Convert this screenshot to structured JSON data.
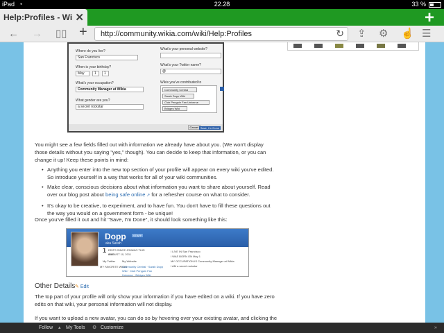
{
  "status": {
    "carrier": "iPad",
    "wifi": "WiFi",
    "time": "22.28",
    "battery": "33 %",
    "battery_level": 0.33
  },
  "tab": {
    "title": "Help:Profiles - Wiki",
    "close": "✕"
  },
  "toolbar": {
    "url": "http://community.wikia.com/wiki/Help:Profiles"
  },
  "screenshot_form": {
    "fields": [
      {
        "label": "Where do you live?",
        "value": "San Francisco"
      },
      {
        "label": "When is your birthday?",
        "month": "May",
        "day": "1",
        "year": "1"
      },
      {
        "label": "What's your occupation?",
        "value": "Community Manager at Wikia"
      },
      {
        "label": "What gender are you?",
        "value": "a secret rockstar"
      }
    ],
    "right_fields": [
      {
        "label": "What's your personal website?",
        "value": ""
      },
      {
        "label": "What's your Twitter name?",
        "value": "@"
      },
      {
        "label": "Wikis you've contributed to",
        "value": ""
      }
    ],
    "wikis": [
      "Community Central",
      "Sarah Dopp Wiki",
      "Club Penguin Fan Universe",
      "Bridges Wiki"
    ],
    "cancel": "Cancel",
    "save": "Save, I'm Done"
  },
  "paragraph1": "You might see a few fields filled out with information we already have about you. (We won't display those details without you saying \"yes,\" though). You can decide to keep that information, or you can change it up! Keep these points in mind:",
  "bullets": [
    "Anything you enter into the new top section of your profile will appear on every wiki you've edited. So introduce yourself in a way that works for all of your wiki communities.",
    {
      "before": "Make clear, conscious decisions about what information you want to share about yourself. Read over our blog post about ",
      "link": "being safe online",
      "after": " for a refresher course on what to consider."
    },
    "It's okay to be creative, to experiment, and to have fun. You don't have to fill these questions out the way you would on a government form - be unique!"
  ],
  "paragraph2": "Once you've filled it out and hit \"Save, I'm Done\", it should look something like this:",
  "dopp": {
    "name": "Dopp",
    "badge": "STAFF",
    "aka": "aka Sarah",
    "edits_count": "1",
    "edits_label": "EDITS SINCE JOINING THIS WIKI",
    "joined": "AUGUST 10, 2011",
    "twitter": "My Twitter",
    "website": "My Website",
    "favorite_wikis_label": "MY FAVORITE WIKIS",
    "favorite_wikis": "Community Central · Sarah Dopp Wiki · Club Penguin Fan Universe · Bridges Wiki",
    "live": "I LIVE IN San Francisco",
    "born": "I WAS BORN ON May 1",
    "occupation": "MY OCCUPATION IS Community Manager at Wikia",
    "gender": "I AM a secret rockstar"
  },
  "other_details": {
    "heading": "Other Details",
    "edit": "Edit"
  },
  "paragraph3": "The top part of your profile will only show your information if you have edited on a wiki. If you have zero edits on that wiki, your personal information will not display.",
  "paragraph4": "If you want to upload a new avatar, you can do so by hovering over your existing avatar, and clicking the \"Edit",
  "bottombar": {
    "follow": "Follow",
    "mytools": "My Tools",
    "customize": "Customize"
  }
}
